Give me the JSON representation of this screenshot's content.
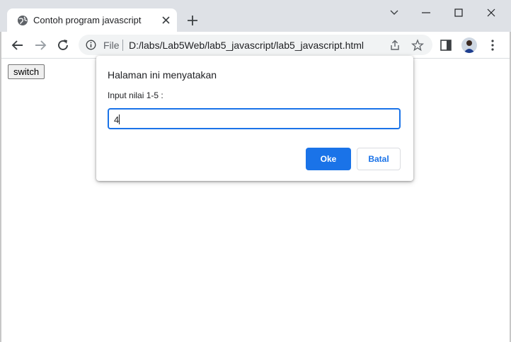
{
  "browser": {
    "tab": {
      "title": "Contoh program javascript",
      "icon": "globe-icon"
    },
    "address_bar": {
      "scheme_label": "File",
      "url": "D:/labs/Lab5Web/lab5_javascript/lab5_javascript.html"
    }
  },
  "page": {
    "switch_button_label": "switch"
  },
  "dialog": {
    "heading": "Halaman ini menyatakan",
    "message": "Input nilai 1-5 :",
    "input_value": "4",
    "ok_label": "Oke",
    "cancel_label": "Batal"
  },
  "colors": {
    "accent": "#1a73e8",
    "tabstrip": "#dee1e6"
  }
}
